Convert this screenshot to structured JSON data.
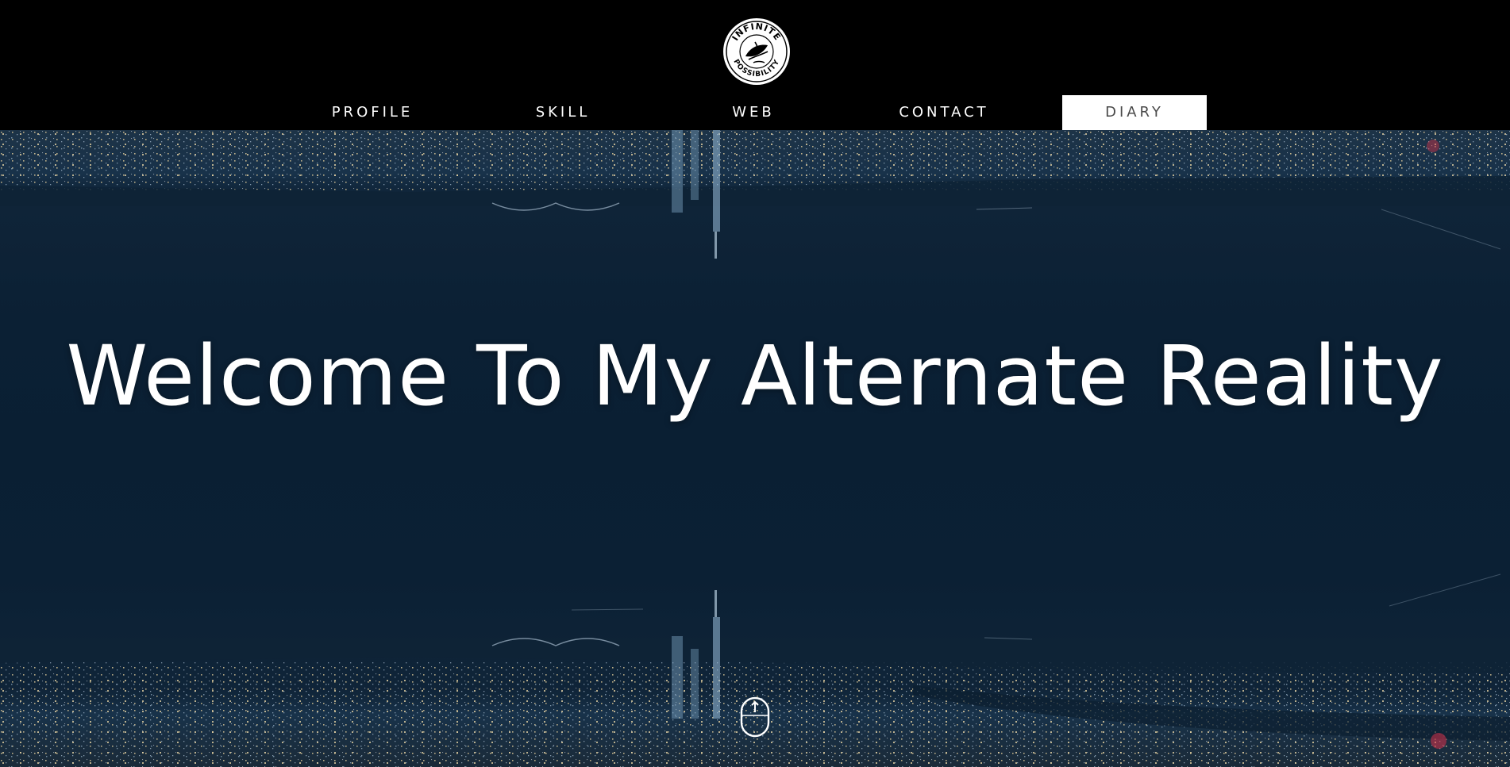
{
  "header": {
    "logo": {
      "top_text": "INFINITE",
      "bottom_text": "POSSIBILITY",
      "icon": "leaf-emblem-icon"
    },
    "nav": {
      "items": [
        {
          "label": "PROFILE",
          "active": false
        },
        {
          "label": "SKILL",
          "active": false
        },
        {
          "label": "WEB",
          "active": false
        },
        {
          "label": "CONTACT",
          "active": false
        },
        {
          "label": "DIARY",
          "active": true
        }
      ]
    }
  },
  "hero": {
    "title": "Welcome To My Alternate Reality",
    "background": "mirrored-night-city-skyline",
    "scroll_icon": "mouse-scroll-icon"
  },
  "colors": {
    "header_bg": "#000000",
    "hero_bg": "#0b2034",
    "nav_text": "#ffffff",
    "nav_active_bg": "#ffffff",
    "nav_active_text": "#4a4a4a",
    "title_text": "#ffffff"
  }
}
